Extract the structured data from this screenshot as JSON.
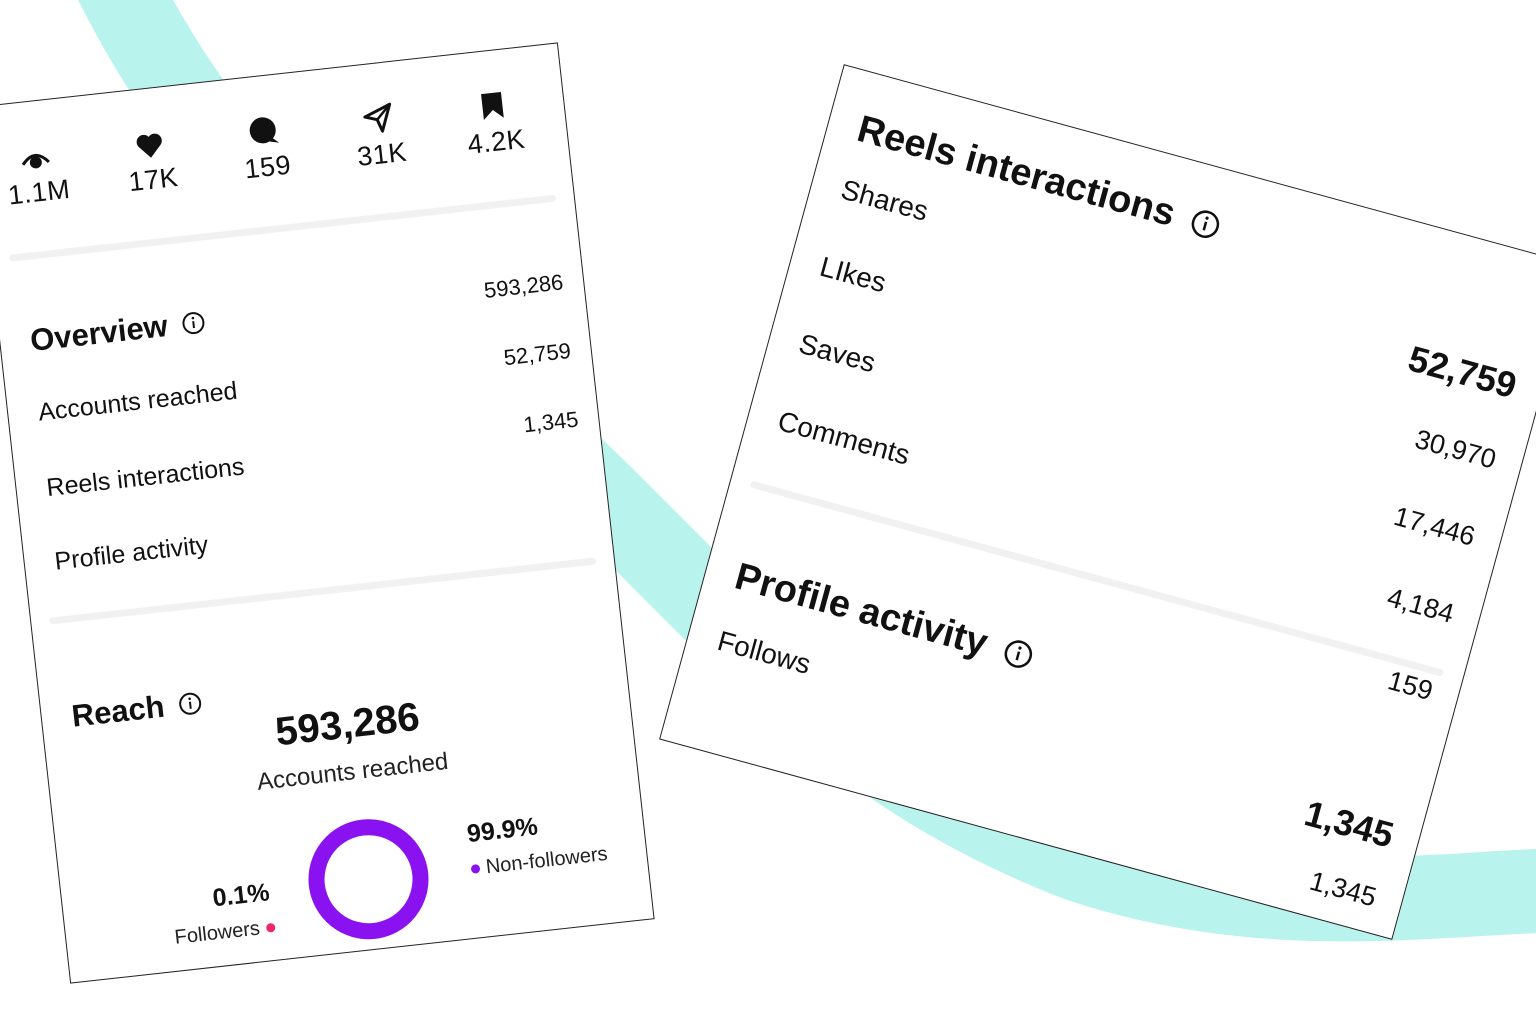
{
  "colors": {
    "accent_teal": "#b8f3ee",
    "donut_purple": "#8a12f0",
    "followers_dot": "#f0256b",
    "nonfollowers_dot": "#8a12f0"
  },
  "stats": [
    {
      "icon": "eye-icon",
      "value": "1.1M"
    },
    {
      "icon": "heart-icon",
      "value": "17K"
    },
    {
      "icon": "comment-icon",
      "value": "159"
    },
    {
      "icon": "send-icon",
      "value": "31K"
    },
    {
      "icon": "bookmark-icon",
      "value": "4.2K"
    }
  ],
  "overview": {
    "title": "Overview",
    "rows": [
      {
        "label": "Accounts reached",
        "value": "593,286"
      },
      {
        "label": "Reels interactions",
        "value": "52,759"
      },
      {
        "label": "Profile activity",
        "value": "1,345"
      }
    ]
  },
  "reach": {
    "title": "Reach",
    "total": "593,286",
    "total_label": "Accounts reached",
    "followers_pct": "0.1%",
    "followers_label": "Followers",
    "nonfollowers_pct": "99.9%",
    "nonfollowers_label": "Non-followers",
    "nonfollowers_fraction": 0.999
  },
  "reels": {
    "title": "Reels interactions",
    "total": "52,759",
    "rows": [
      {
        "label": "Shares",
        "value": "30,970"
      },
      {
        "label": "LIkes",
        "value": "17,446"
      },
      {
        "label": "Saves",
        "value": "4,184"
      },
      {
        "label": "Comments",
        "value": "159"
      }
    ]
  },
  "profile": {
    "title": "Profile activity",
    "total": "1,345",
    "rows": [
      {
        "label": "Follows",
        "value": "1,345"
      }
    ]
  }
}
